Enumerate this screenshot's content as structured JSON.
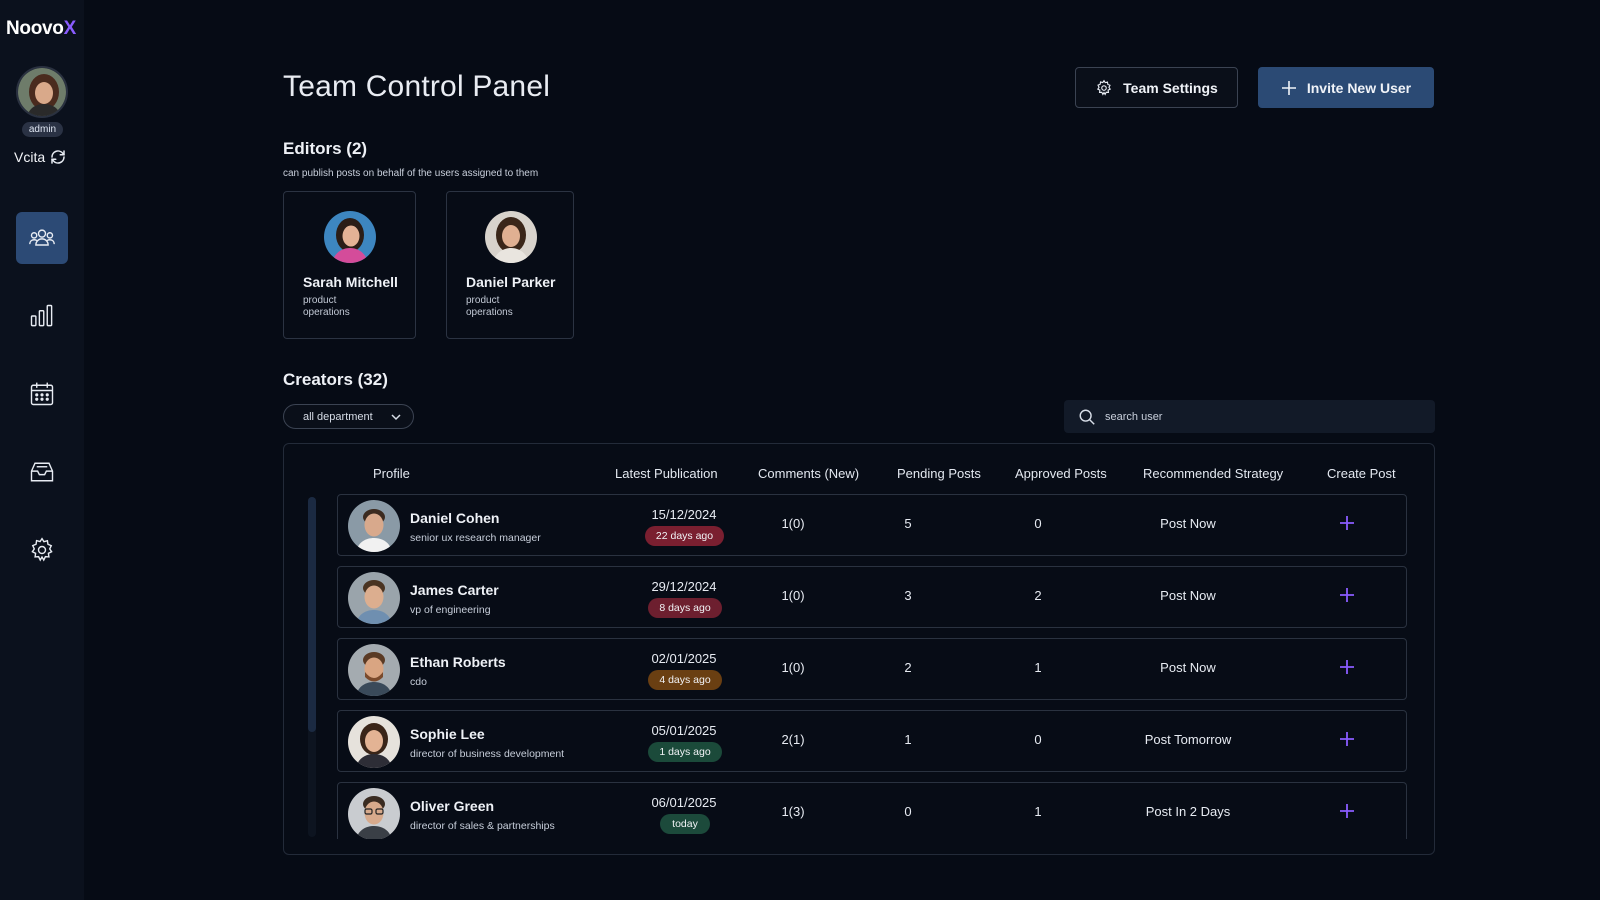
{
  "brand": {
    "name_main": "Noovo",
    "name_accent": "X"
  },
  "user": {
    "role_badge": "admin",
    "workspace": "Vcita"
  },
  "nav": [
    {
      "icon": "team-icon",
      "active": true
    },
    {
      "icon": "analytics-icon",
      "active": false
    },
    {
      "icon": "calendar-icon",
      "active": false
    },
    {
      "icon": "inbox-icon",
      "active": false
    },
    {
      "icon": "gear-icon",
      "active": false
    }
  ],
  "header": {
    "title": "Team Control Panel",
    "settings_label": "Team Settings",
    "invite_label": "Invite New User"
  },
  "editors": {
    "title": "Editors (2)",
    "subtitle": "can publish posts on behalf of the users assigned to them",
    "items": [
      {
        "name": "Sarah Mitchell",
        "role": "product operations"
      },
      {
        "name": "Daniel Parker",
        "role": "product operations"
      }
    ]
  },
  "creators": {
    "title": "Creators (32)",
    "department_filter": "all department",
    "search_placeholder": "search user",
    "columns": {
      "profile": "Profile",
      "latest": "Latest Publication",
      "comments": "Comments (New)",
      "pending": "Pending Posts",
      "approved": "Approved Posts",
      "strategy": "Recommended Strategy",
      "create": "Create Post"
    },
    "rows": [
      {
        "name": "Daniel Cohen",
        "role": "senior ux research manager",
        "date": "15/12/2024",
        "ago": "22 days ago",
        "ago_color": "#7a1f30",
        "comments": "1(0)",
        "pending": "5",
        "approved": "0",
        "strategy": "Post Now"
      },
      {
        "name": "James Carter",
        "role": "vp of engineering",
        "date": "29/12/2024",
        "ago": "8 days ago",
        "ago_color": "#6d1f2f",
        "comments": "1(0)",
        "pending": "3",
        "approved": "2",
        "strategy": "Post Now"
      },
      {
        "name": "Ethan Roberts",
        "role": "cdo",
        "date": "02/01/2025",
        "ago": "4 days ago",
        "ago_color": "#6a3f12",
        "comments": "1(0)",
        "pending": "2",
        "approved": "1",
        "strategy": "Post Now"
      },
      {
        "name": "Sophie Lee",
        "role": "director of business development",
        "date": "05/01/2025",
        "ago": "1 days ago",
        "ago_color": "#1b4a3a",
        "comments": "2(1)",
        "pending": "1",
        "approved": "0",
        "strategy": "Post Tomorrow"
      },
      {
        "name": "Oliver Green",
        "role": "director of sales & partnerships",
        "date": "06/01/2025",
        "ago": "today",
        "ago_color": "#1c4a3b",
        "comments": "1(3)",
        "pending": "0",
        "approved": "1",
        "strategy": "Post In 2 Days"
      }
    ]
  },
  "colors": {
    "accent": "#8a5cff",
    "primary_button": "#2b4a74",
    "background": "#060b15",
    "sidebar": "#0b111d"
  }
}
